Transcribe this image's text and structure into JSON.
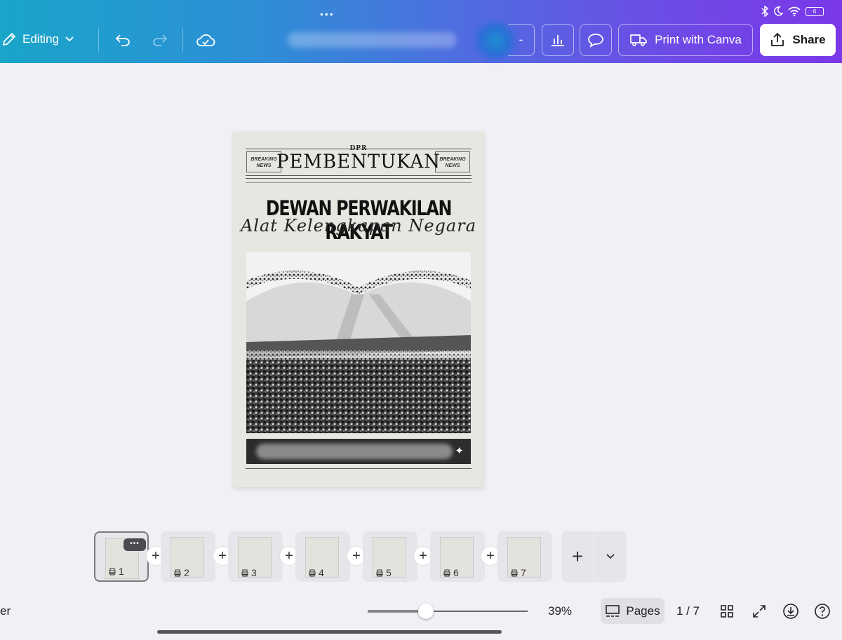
{
  "topbar": {
    "editing_label": "Editing",
    "print_label": "Print with Canva",
    "share_label": "Share",
    "title_hidden": "",
    "collab_suffix": "-"
  },
  "status_bar": {
    "battery": "6",
    "icons": [
      "bluetooth-icon",
      "moon-icon",
      "wifi-icon",
      "battery-icon"
    ]
  },
  "page": {
    "masthead_small": "DPR",
    "masthead": "PEMBENTUKAN",
    "left_box": "BREAKING NEWS",
    "right_box": "BREAKING NEWS",
    "headline": "DEWAN PERWAKILAN RAKYAT",
    "script_line": "Alat Kelengkapan Negara"
  },
  "thumbnails": [
    {
      "num": "1",
      "active": true
    },
    {
      "num": "2",
      "active": false
    },
    {
      "num": "3",
      "active": false
    },
    {
      "num": "4",
      "active": false
    },
    {
      "num": "5",
      "active": false
    },
    {
      "num": "6",
      "active": false
    },
    {
      "num": "7",
      "active": false
    }
  ],
  "bottom": {
    "left_partial": "er",
    "zoom": "39%",
    "zoom_fraction": 0.36,
    "pages_label": "Pages",
    "page_counter": "1 / 7"
  },
  "colors": {
    "topbar_start": "#1aa5c9",
    "topbar_end": "#7a38e8",
    "background": "#f0f1f5"
  }
}
